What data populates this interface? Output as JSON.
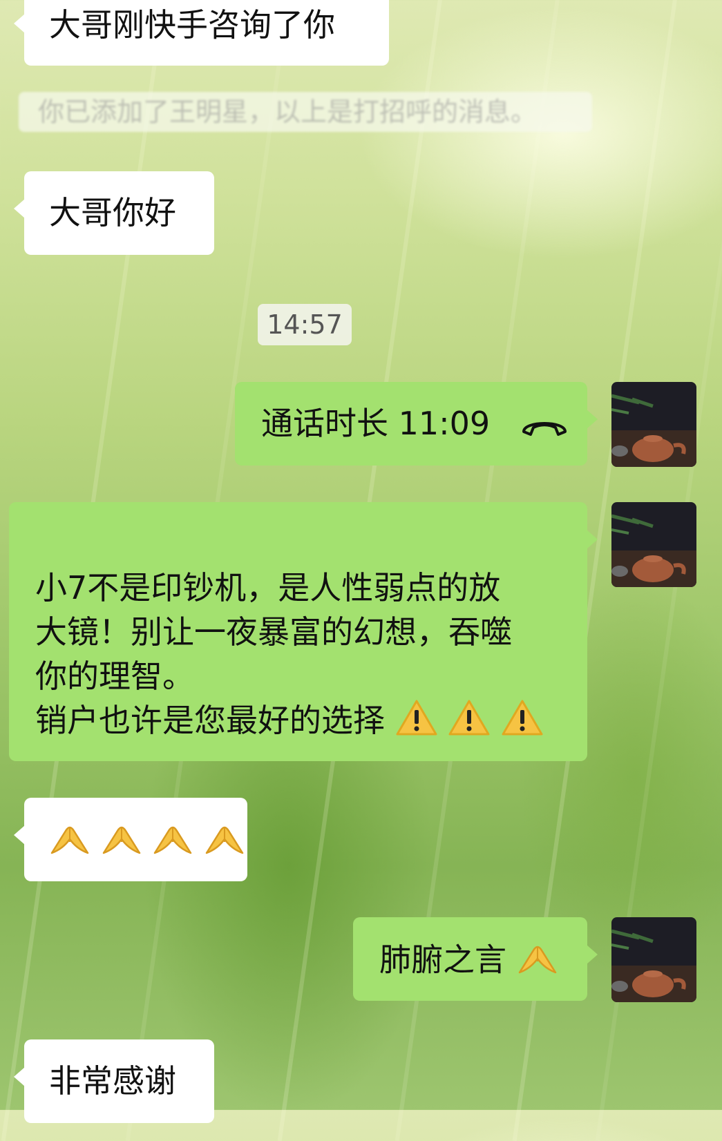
{
  "chat": {
    "messages": [
      {
        "text": "大哥刚快手咨询了你"
      },
      {
        "text": "你已添加了王明星，以上是打招呼的消息。"
      },
      {
        "text": "大哥你好"
      },
      {
        "text": "14:57"
      },
      {
        "text": "通话时长 11:09",
        "icon": "phone-hangup-icon"
      },
      {
        "lines": [
          "小7不是印钞机，是人性弱点的放",
          "大镜！别让一夜暴富的幻想，吞噬",
          "你的理智。",
          "销户也许是您最好的选择"
        ],
        "icons": [
          "warning-icon",
          "warning-icon",
          "warning-icon"
        ]
      },
      {
        "icons": [
          "prayer-hands-icon",
          "prayer-hands-icon",
          "prayer-hands-icon",
          "prayer-hands-icon"
        ]
      },
      {
        "text": "肺腑之言",
        "icon": "prayer-hands-icon"
      },
      {
        "text": "非常感谢"
      }
    ]
  },
  "colors": {
    "incoming_bubble": "#ffffff",
    "outgoing_bubble": "#a3e16f",
    "timestamp_bg": "#f5f5f0"
  },
  "avatar": {
    "icon": "teapot-avatar-icon"
  }
}
